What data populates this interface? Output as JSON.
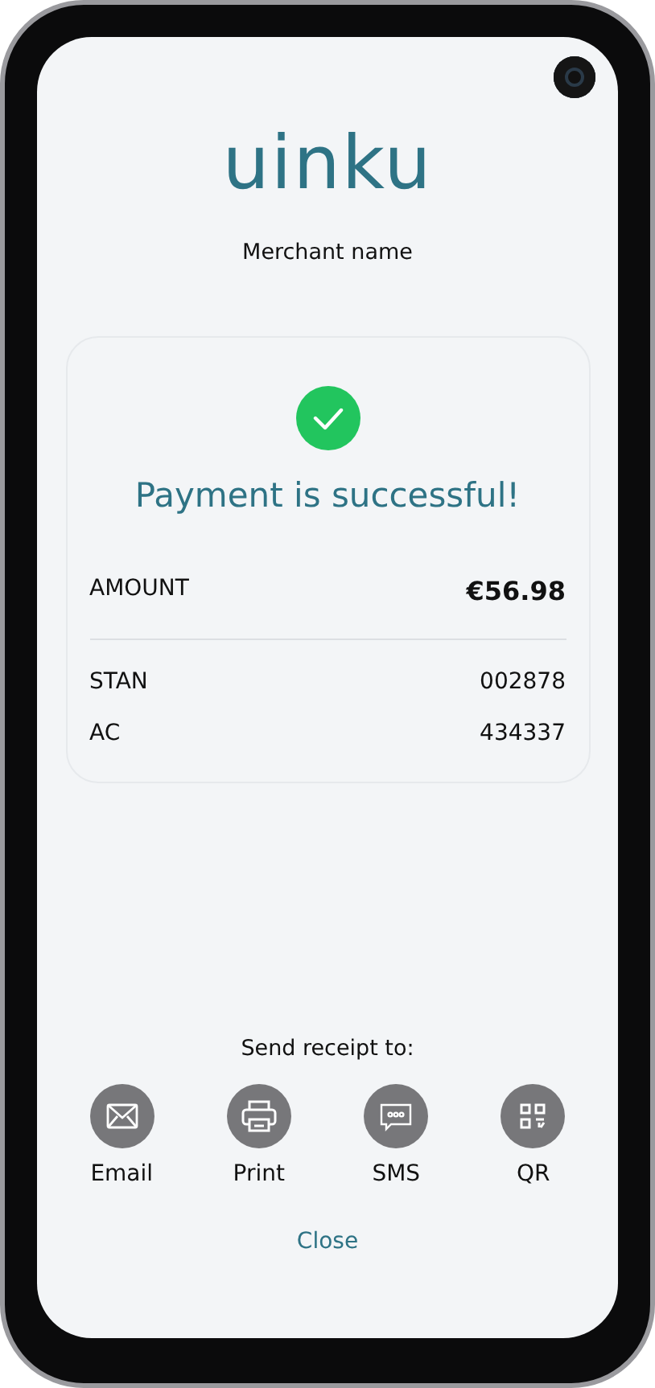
{
  "logo": "uinku",
  "merchant_name": "Merchant name",
  "status": {
    "kind": "success",
    "title": "Payment is successful!"
  },
  "amount": {
    "label": "AMOUNT",
    "value": "€56.98"
  },
  "details": [
    {
      "label": "STAN",
      "value": "002878"
    },
    {
      "label": "AC",
      "value": "434337"
    }
  ],
  "receipt": {
    "heading": "Send receipt to:",
    "options": [
      {
        "kind": "email",
        "label": "Email"
      },
      {
        "kind": "print",
        "label": "Print"
      },
      {
        "kind": "sms",
        "label": "SMS"
      },
      {
        "kind": "qr",
        "label": "QR"
      }
    ]
  },
  "close_link": "Close"
}
